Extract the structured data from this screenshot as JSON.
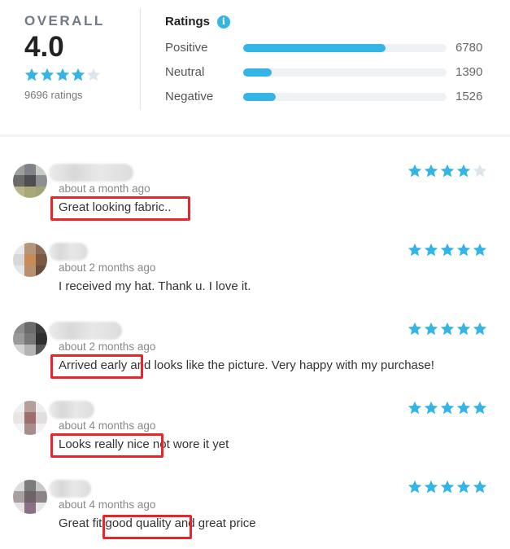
{
  "summary": {
    "overall_label": "OVERALL",
    "score": "4.0",
    "stars": 4,
    "ratings_count": "9696 ratings",
    "ratings_title": "Ratings",
    "info_glyph": "i",
    "accent_color": "#35b5e5",
    "breakdown": [
      {
        "label": "Positive",
        "count": "6780",
        "fraction": 0.7
      },
      {
        "label": "Neutral",
        "count": "1390",
        "fraction": 0.14
      },
      {
        "label": "Negative",
        "count": "1526",
        "fraction": 0.16
      }
    ]
  },
  "reviews": [
    {
      "time": "about a month ago",
      "text": "Great looking fabric..",
      "stars": 4
    },
    {
      "time": "about 2 months ago",
      "text": "I received my hat. Thank u. I love it.",
      "stars": 5
    },
    {
      "time": "about 2 months ago",
      "text": "Arrived early and looks like the picture. Very happy with my purchase!",
      "stars": 5
    },
    {
      "time": "about 4 months ago",
      "text": "Looks really nice not wore it yet",
      "stars": 5
    },
    {
      "time": "about 4 months ago",
      "text": "Great fit,good quality and great price",
      "stars": 5
    }
  ],
  "highlight_color": "#e8262a"
}
